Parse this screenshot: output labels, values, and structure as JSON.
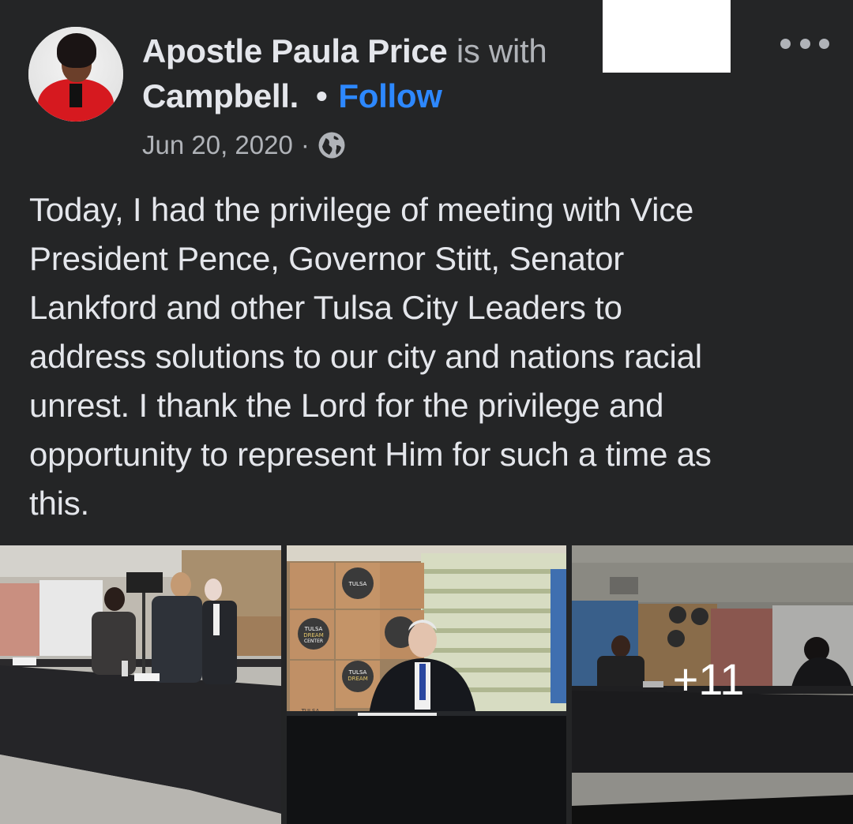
{
  "post": {
    "author": "Apostle Paula Price",
    "with_text": "is with",
    "tagged_name": "Campbell.",
    "separator": "•",
    "follow_label": "Follow",
    "date": "Jun 20, 2020",
    "meta_separator": "·",
    "privacy_icon": "globe-icon",
    "body": "Today, I had the privilege of meeting with Vice\nPresident Pence, Governor Stitt, Senator\nLankford and other Tulsa City Leaders to\naddress solutions to our city and nations racial\nunrest. I thank the Lord for the privilege and\nopportunity to represent Him for such a time as\nthis."
  },
  "photos": {
    "more_count": "+11",
    "box_label_1": "TULSA",
    "box_label_2": "DREAM",
    "box_label_3": "CENTER"
  },
  "colors": {
    "background": "#242526",
    "text": "#e4e6eb",
    "muted": "#b0b3b8",
    "link": "#2d88ff"
  }
}
